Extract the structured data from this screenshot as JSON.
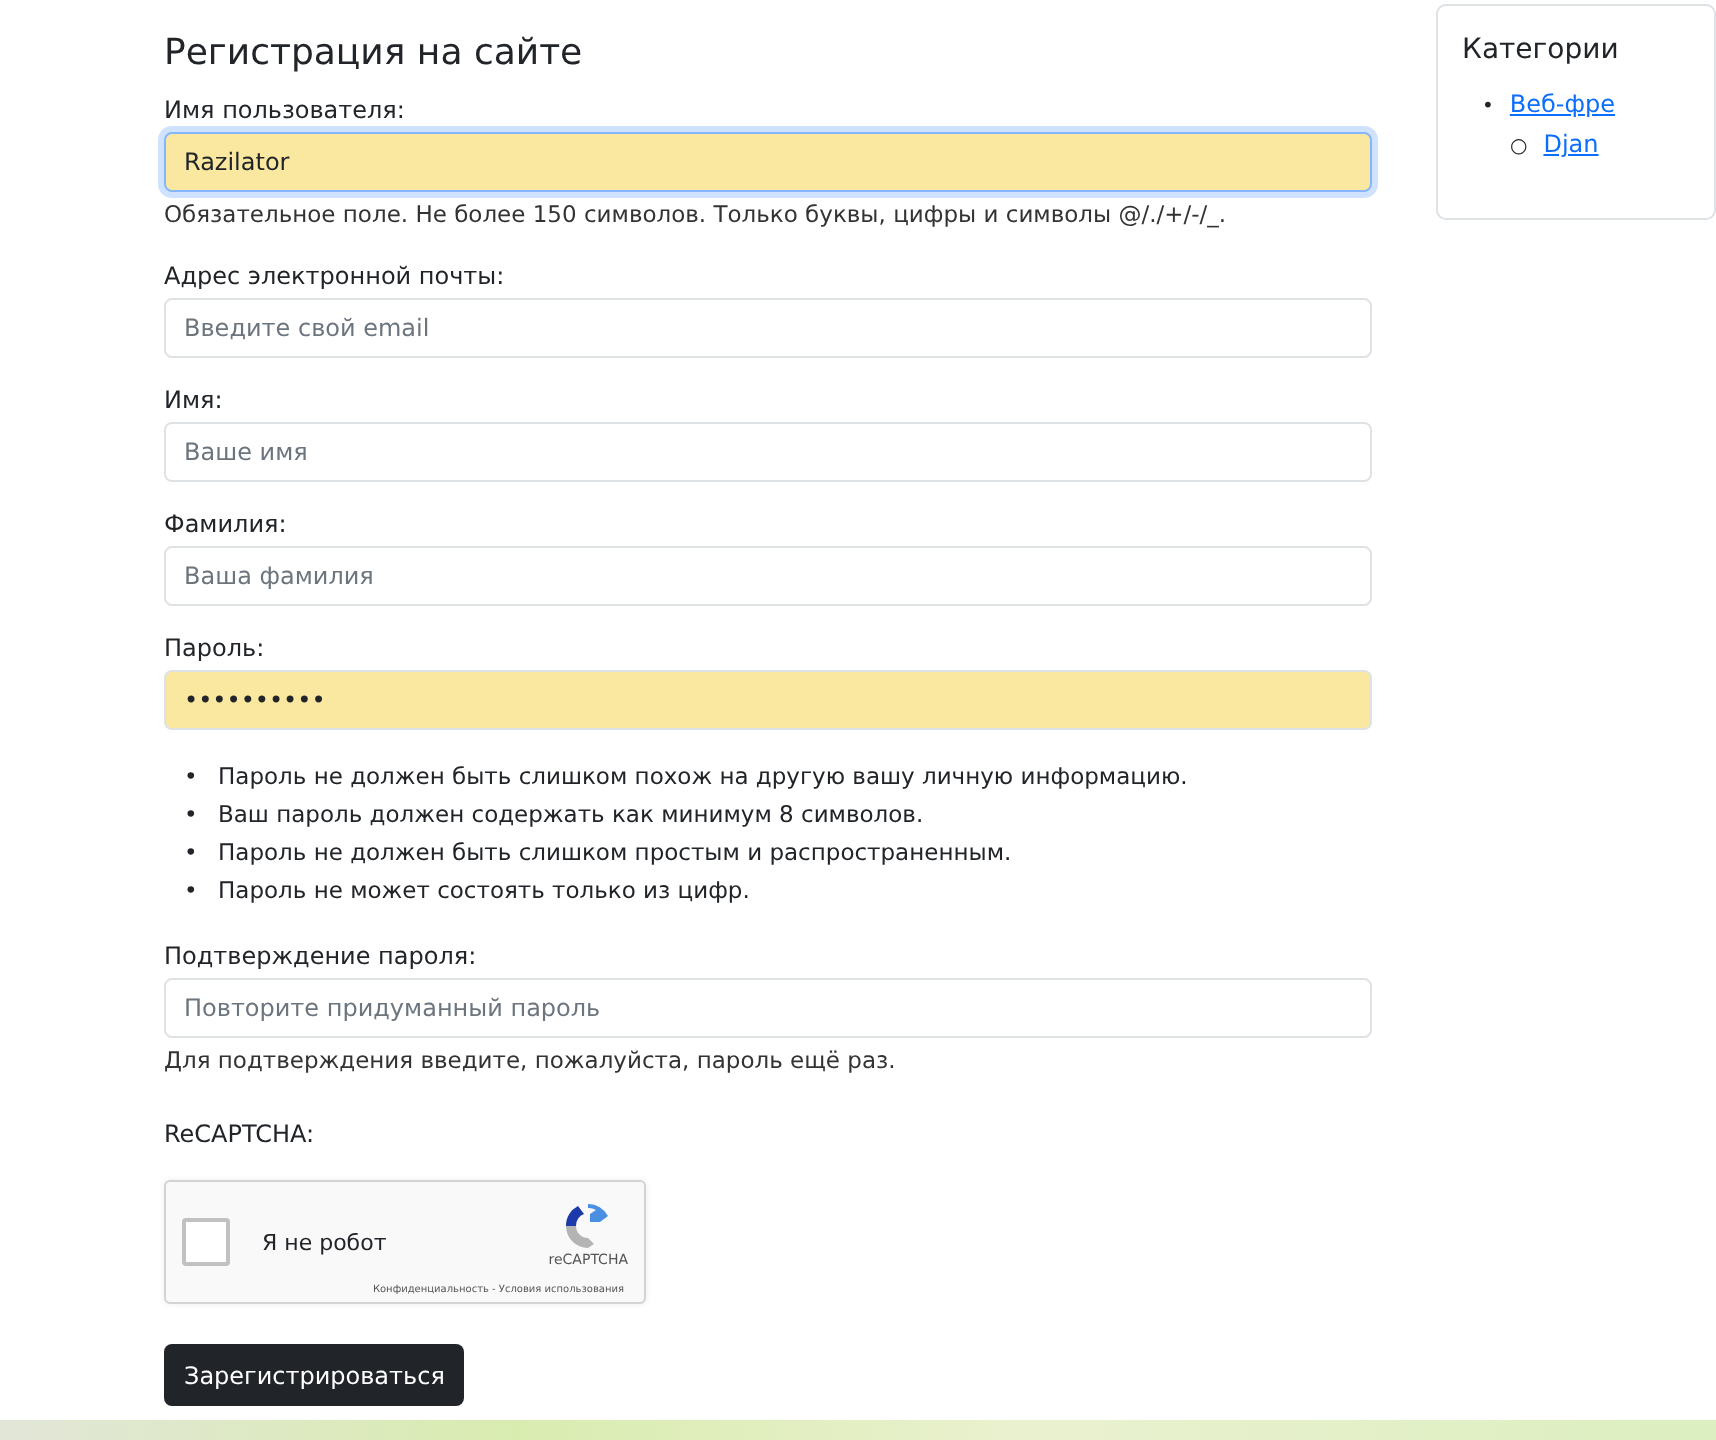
{
  "title": "Регистрация на сайте",
  "fields": [
    {
      "label": "Имя пользователя:",
      "value": "Razilator",
      "autofilled": true,
      "focused": true,
      "help": "Обязательное поле. Не более 150 символов. Только буквы, цифры и символы @/./+/-/_."
    },
    {
      "label": "Адрес электронной почты:",
      "placeholder": "Введите свой email",
      "autofilled": false,
      "focused": false
    },
    {
      "label": "Имя:",
      "placeholder": "Ваше имя",
      "autofilled": false,
      "focused": false
    },
    {
      "label": "Фамилия:",
      "placeholder": "Ваша фамилия",
      "autofilled": false,
      "focused": false
    },
    {
      "label": "Пароль:",
      "value": "••••••••••",
      "autofilled": true,
      "focused": false,
      "hints": [
        {
          "marker": "•",
          "text": "Пароль не должен быть слишком похож на другую вашу личную информацию."
        },
        {
          "marker": "•",
          "text": "Ваш пароль должен содержать как минимум 8 символов."
        },
        {
          "marker": "•",
          "text": "Пароль не должен быть слишком простым и распространенным."
        },
        {
          "marker": "•",
          "text": "Пароль не может состоять только из цифр."
        }
      ]
    },
    {
      "label": "Подтверждение пароля:",
      "placeholder": "Повторите придуманный пароль",
      "autofilled": false,
      "focused": false,
      "help": "Для подтверждения введите, пожалуйста, пароль ещё раз."
    }
  ],
  "captcha": {
    "label": "ReCAPTCHA:",
    "checkbox_label": "Я не робот",
    "checked": false,
    "brand": "reCAPTCHA",
    "links": "Конфиденциальность - Условия использования"
  },
  "submit": "Зарегистрироваться",
  "sidebar": {
    "title": "Категории",
    "items": [
      {
        "marker": "•",
        "label": "Веб-фре",
        "children": [
          {
            "marker": "○",
            "label": "Djan"
          }
        ]
      }
    ]
  }
}
